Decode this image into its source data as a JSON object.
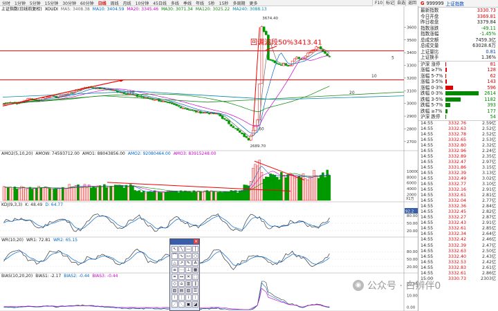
{
  "toolbar": {
    "items": [
      "分时",
      "1分钟",
      "5分钟",
      "15分钟",
      "30分钟",
      "60分钟",
      "日线",
      "周线",
      "月线",
      "10分钟",
      "45日线",
      "多线",
      "季线",
      "年线",
      "5秒",
      "15秒",
      "多周期",
      "更多"
    ],
    "active_index": 6,
    "right_buttons": [
      "F10",
      "标记",
      "自选",
      "返回"
    ]
  },
  "main_legend": {
    "title": "上证指数(日线前复权)",
    "xoudi": "XOUDI",
    "ma5": "MA5: 3408.38",
    "ma10": "MA10: 3404.59",
    "ma20": "MA20: 3345.46",
    "ma30": "MA30: 3071.34",
    "ma120": "MA120: 3025.22",
    "ma240": "MA240: 3088.13"
  },
  "annotation": {
    "text": "回调波段50%3413.41",
    "high": "3674.40",
    "low": "2689.70",
    "n120": "120",
    "n60": "60",
    "n20": "20",
    "n10": "10",
    "n5": "5"
  },
  "price_axis": [
    "3600",
    "3500",
    "3400",
    "3300",
    "3200",
    "3100",
    "3000",
    "2900",
    "2800",
    "2700"
  ],
  "vol_legend": {
    "title": "AMO2(5,10,20)",
    "amow": "AMOW: 74593712.00",
    "amo1": "AMO1: 88043856.00",
    "amo2": "AMO2: 92080464.00",
    "amo3": "AMO3: 83915248.00"
  },
  "vol_axis": [
    "10000",
    "8000",
    "6000",
    "4000",
    "2000"
  ],
  "vol_unit": "X1万",
  "kdj_legend": {
    "title": "KDJ(9,3,3)",
    "k": "K: 48.49",
    "d": "D: 64.77",
    "value": "92.2"
  },
  "kdj_axis": [
    "80.00",
    "50.00",
    "20.00"
  ],
  "wr_legend": {
    "title": "WR(10,20)",
    "wr1": "WR1: 72.81",
    "wr2": "WR2: 65.15"
  },
  "wr_axis": [
    "80.00",
    "50.00",
    "20.00"
  ],
  "bias_legend": {
    "title": "BIAS(10,20,20)",
    "b1": "BIAS1: -2.17",
    "b2": "BIAS2: -0.44",
    "b3": "BIAS3: -0.44"
  },
  "bias_axis": [
    "20.00",
    "10.00",
    "0.00"
  ],
  "side": {
    "code": "999999",
    "name": "上证指数",
    "quote": [
      {
        "label": "最新指数",
        "value": "3330.73",
        "cls": "red"
      },
      {
        "label": "今日开盘",
        "value": "3369.81",
        "cls": "red"
      },
      {
        "label": "昨日收盘",
        "value": "3379.84",
        "cls": ""
      },
      {
        "label": "指数涨跌",
        "value": "-49.11",
        "cls": "green"
      },
      {
        "label": "指数涨幅",
        "value": "-1.45%",
        "cls": "green"
      },
      {
        "label": "总成交额",
        "value": "7459.3亿",
        "cls": ""
      },
      {
        "label": "总成交量",
        "value": "63028.6万",
        "cls": ""
      },
      {
        "label": "上证量比",
        "value": "0.81",
        "cls": "blue"
      },
      {
        "label": "上证换手",
        "value": "1.36%",
        "cls": ""
      }
    ],
    "dist": [
      {
        "label": "沪深 涨停",
        "value": "81",
        "cls": "red",
        "w": 0.02,
        "color": "#d00"
      },
      {
        "label": "涨幅 ≥7%",
        "value": "128",
        "cls": "red",
        "w": 0.05,
        "color": "#d00"
      },
      {
        "label": "涨幅 5-7%",
        "value": "62",
        "cls": "red",
        "w": 0.02,
        "color": "#d00"
      },
      {
        "label": "涨幅 3-5%",
        "value": "143",
        "cls": "red",
        "w": 0.05,
        "color": "#d00"
      },
      {
        "label": "涨幅 0-3%",
        "value": "596",
        "cls": "red",
        "w": 0.23,
        "color": "#d00"
      },
      {
        "label": "跌幅 0-3%",
        "value": "2614",
        "cls": "green",
        "w": 1.0,
        "color": "#080"
      },
      {
        "label": "跌幅 3-5%",
        "value": "1182",
        "cls": "green",
        "w": 0.45,
        "color": "#080"
      },
      {
        "label": "跌幅 5-7%",
        "value": "393",
        "cls": "green",
        "w": 0.15,
        "color": "#080"
      },
      {
        "label": "跌幅 ≥7%",
        "value": "177",
        "cls": "green",
        "w": 0.07,
        "color": "#080"
      },
      {
        "label": "沪深 跌停",
        "value": "54",
        "cls": "green",
        "w": 0.02,
        "color": "#080"
      }
    ],
    "ticks": [
      {
        "t": "14:55",
        "p": "3332.76",
        "v": "2.59"
      },
      {
        "t": "14:55",
        "p": "3332.63",
        "v": "2.52"
      },
      {
        "t": "14:55",
        "p": "3332.78",
        "v": "2.52"
      },
      {
        "t": "14:55",
        "p": "3332.65",
        "p2": "",
        "v": "2.53"
      },
      {
        "t": "14:55",
        "p": "3332.80",
        "v": "2.32"
      },
      {
        "t": "14:55",
        "p": "3332.96",
        "v": "2.24"
      },
      {
        "t": "14:55",
        "p": "3332.89",
        "v": "2.35"
      },
      {
        "t": "14:55",
        "p": "3332.47",
        "v": "2.97"
      },
      {
        "t": "14:55",
        "p": "3331.86",
        "v": "3.15"
      },
      {
        "t": "14:55",
        "p": "3332.39",
        "v": "3.13"
      },
      {
        "t": "14:55",
        "p": "3332.49",
        "v": "3.02"
      },
      {
        "t": "14:55",
        "p": "3332.77",
        "v": "3.10"
      },
      {
        "t": "14:55",
        "p": "3332.16",
        "v": "2.91"
      },
      {
        "t": "14:55",
        "p": "3332.61",
        "v": "2.81"
      },
      {
        "t": "14:55",
        "p": "3332.04",
        "v": "2.77"
      },
      {
        "t": "14:55",
        "p": "3332.36",
        "v": "2.84"
      },
      {
        "t": "14:55",
        "p": "3332.45",
        "v": "2.82"
      },
      {
        "t": "14:55",
        "p": "3332.27",
        "v": "2.87"
      },
      {
        "t": "14:55",
        "p": "3332.43",
        "v": "2.91"
      },
      {
        "t": "14:55",
        "p": "3332.61",
        "v": "2.85"
      },
      {
        "t": "14:55",
        "p": "3332.34",
        "v": "2.64"
      },
      {
        "t": "14:55",
        "p": "3332.42",
        "v": "2.46"
      },
      {
        "t": "14:55",
        "p": "3332.39",
        "v": "2.47"
      },
      {
        "t": "14:55",
        "p": "3332.63",
        "v": "2.50"
      },
      {
        "t": "14:55",
        "p": "3332.40",
        "v": "2.43"
      },
      {
        "t": "14:55",
        "p": "3332.53",
        "v": "2.42"
      },
      {
        "t": "14:55",
        "p": "3332.83",
        "v": "2.61"
      },
      {
        "t": "14:55",
        "p": "3332.61",
        "v": "2.86"
      },
      {
        "t": "15:00",
        "p": "3330.73",
        "v": "2303"
      }
    ],
    "tick_unit": "亿"
  },
  "tools": {
    "labels": [
      "↖",
      "╲",
      "—",
      "│",
      "⌒",
      "∿",
      "▭",
      "○",
      "△",
      "↗",
      "✎",
      "A",
      "≡",
      "⋯",
      "⊥",
      "▦",
      "⌗",
      "↔",
      "✕",
      "⬚",
      "◇",
      "⌂",
      "▥",
      "∥",
      "▨",
      "▤",
      "▧",
      "☰",
      "⦚",
      "⋮",
      "⁞",
      "⁝",
      "⋰",
      "⋱",
      "▣",
      "◪"
    ]
  },
  "watermark": {
    "text": "公众号 · 白辨伴0"
  }
}
